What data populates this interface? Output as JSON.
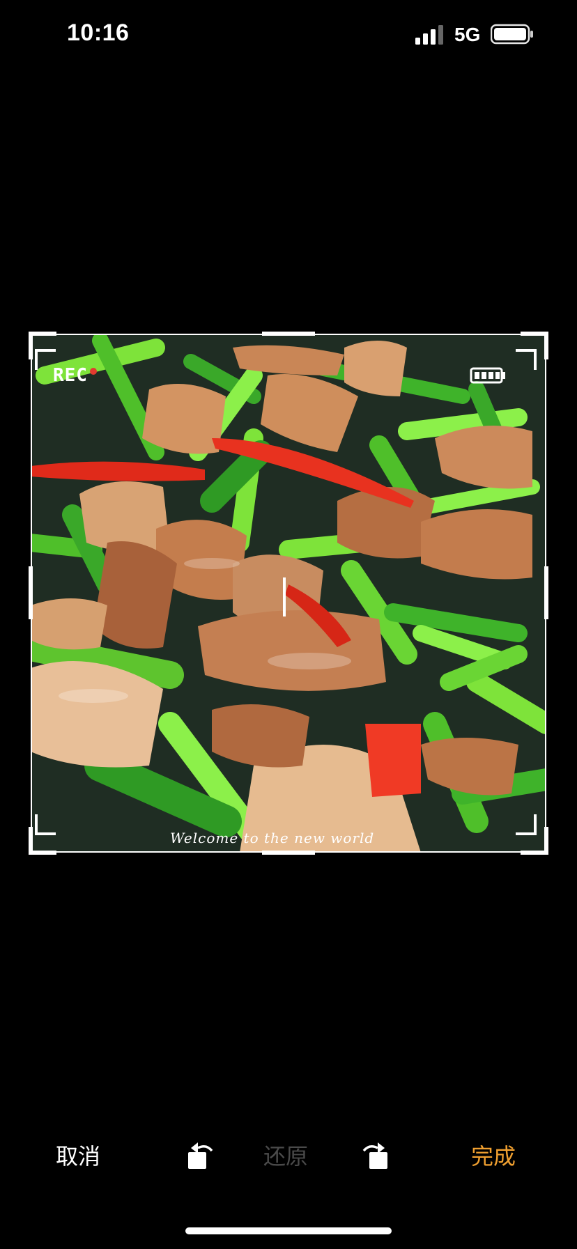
{
  "status_bar": {
    "time": "10:16",
    "network": "5G",
    "signal_icon": "cellular-signal-icon",
    "battery_icon": "battery-icon"
  },
  "photo": {
    "overlay_rec": "REC",
    "overlay_caption": "Welcome to the new world",
    "frame_corners_icon": "camera-frame-corners-icon",
    "overlay_battery_icon": "camera-battery-icon"
  },
  "toolbar": {
    "cancel_label": "取消",
    "restore_label": "还原",
    "done_label": "完成",
    "rotate_left_icon": "rotate-left-icon",
    "rotate_right_icon": "rotate-right-icon"
  },
  "colors": {
    "background": "#000000",
    "done_accent": "#f0a030",
    "disabled_text": "#4a4a4a"
  }
}
